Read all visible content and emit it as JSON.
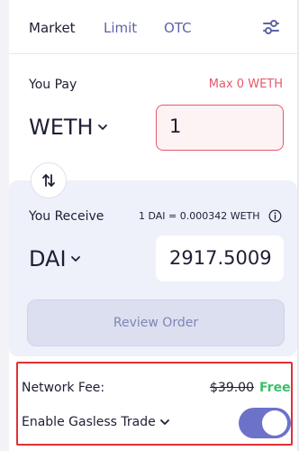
{
  "tabs": {
    "market": "Market",
    "limit": "Limit",
    "otc": "OTC"
  },
  "pay": {
    "label": "You Pay",
    "max": "Max 0 WETH",
    "token": "WETH",
    "amount": "1"
  },
  "receive": {
    "label": "You Receive",
    "rate": "1 DAI = 0.000342 WETH",
    "token": "DAI",
    "amount": "2917.5009"
  },
  "review_button": "Review Order",
  "fee": {
    "label": "Network Fee:",
    "old": "$39.00",
    "free": "Free!"
  },
  "gasless": {
    "label": "Enable Gasless Trade",
    "enabled": true
  },
  "colors": {
    "accent": "#6d72c9",
    "error": "#e5596a",
    "success": "#3cc06a",
    "highlight_border": "#e03036"
  },
  "icons": {
    "settings": "sliders-icon",
    "swap": "swap-arrows-icon",
    "info": "info-icon",
    "chevron": "chevron-down-icon"
  }
}
